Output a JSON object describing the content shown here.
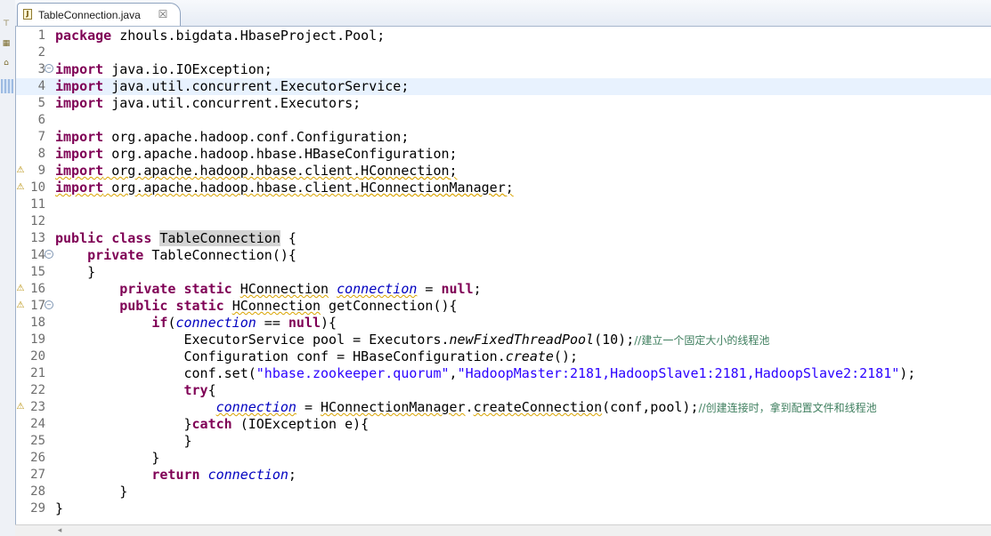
{
  "tab": {
    "title": "TableConnection.java",
    "icon": "java-file-icon",
    "close_glyph": "☒"
  },
  "left_strip": [
    "outline-icon",
    "hierarchy-icon",
    "folder-icon"
  ],
  "editor": {
    "current_line": 4,
    "lines": [
      {
        "n": "1",
        "text": "package zhouls.bigdata.HbaseProject.Pool;"
      },
      {
        "n": "2",
        "text": ""
      },
      {
        "n": "3",
        "text": "import java.io.IOException;",
        "fold": true
      },
      {
        "n": "4",
        "text": "import java.util.concurrent.ExecutorService;",
        "bookmark": true
      },
      {
        "n": "5",
        "text": "import java.util.concurrent.Executors;"
      },
      {
        "n": "6",
        "text": ""
      },
      {
        "n": "7",
        "text": "import org.apache.hadoop.conf.Configuration;"
      },
      {
        "n": "8",
        "text": "import org.apache.hadoop.hbase.HBaseConfiguration;"
      },
      {
        "n": "9",
        "text": "import org.apache.hadoop.hbase.client.HConnection;",
        "warning": true
      },
      {
        "n": "10",
        "text": "import org.apache.hadoop.hbase.client.HConnectionManager;",
        "warning": true
      },
      {
        "n": "11",
        "text": ""
      },
      {
        "n": "12",
        "text": ""
      },
      {
        "n": "13",
        "text": "public class TableConnection {"
      },
      {
        "n": "14",
        "text": "    private TableConnection(){",
        "fold": true
      },
      {
        "n": "15",
        "text": "    }"
      },
      {
        "n": "16",
        "text": "        private static HConnection connection = null;",
        "warning": true
      },
      {
        "n": "17",
        "text": "        public static HConnection getConnection(){",
        "warning": true,
        "fold": true
      },
      {
        "n": "18",
        "text": "            if(connection == null){"
      },
      {
        "n": "19",
        "text": "                ExecutorService pool = Executors.newFixedThreadPool(10);//建立一个固定大小的线程池"
      },
      {
        "n": "20",
        "text": "                Configuration conf = HBaseConfiguration.create();"
      },
      {
        "n": "21",
        "text": "                conf.set(\"hbase.zookeeper.quorum\",\"HadoopMaster:2181,HadoopSlave1:2181,HadoopSlave2:2181\");"
      },
      {
        "n": "22",
        "text": "                try{"
      },
      {
        "n": "23",
        "text": "                    connection = HConnectionManager.createConnection(conf,pool);//创建连接时，拿到配置文件和线程池",
        "warning": true
      },
      {
        "n": "24",
        "text": "                }catch (IOException e){"
      },
      {
        "n": "25",
        "text": "                }"
      },
      {
        "n": "26",
        "text": "            }"
      },
      {
        "n": "27",
        "text": "            return connection;"
      },
      {
        "n": "28",
        "text": "        }"
      },
      {
        "n": "29",
        "text": "}"
      }
    ]
  }
}
